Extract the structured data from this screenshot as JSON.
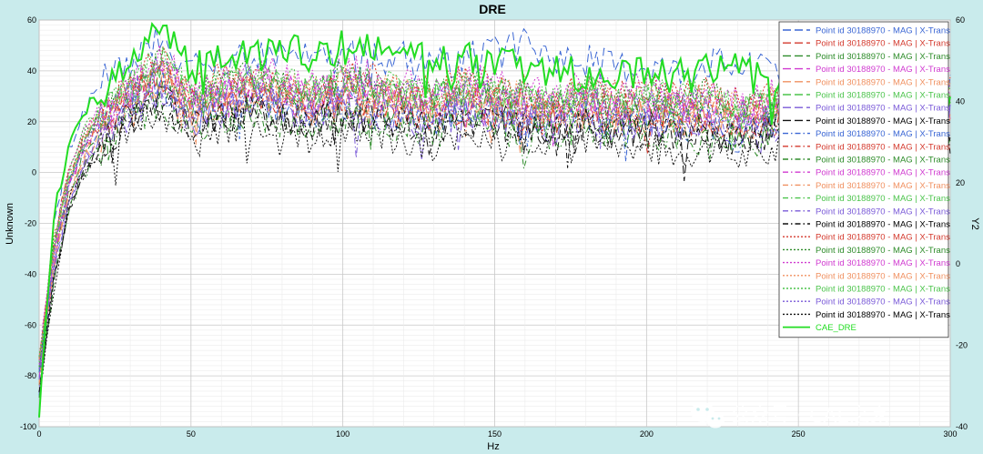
{
  "chart_data": {
    "type": "line",
    "title": "DRE",
    "xlabel": "Hz",
    "ylabel": "Unknown",
    "y2label": "Y2",
    "xlim": [
      0,
      300
    ],
    "ylim": [
      -100,
      60
    ],
    "y2lim": [
      -40,
      60
    ],
    "x_ticks": [
      0,
      50,
      100,
      150,
      200,
      250,
      300
    ],
    "y_ticks": [
      -100,
      -80,
      -60,
      -40,
      -20,
      0,
      20,
      40,
      60
    ],
    "y2_ticks": [
      -40,
      -20,
      0,
      20,
      40,
      60
    ],
    "grid": true,
    "legend_position": "top-right",
    "x": [
      0,
      5,
      10,
      15,
      20,
      25,
      30,
      35,
      40,
      45,
      50,
      60,
      70,
      80,
      90,
      100,
      110,
      120,
      130,
      140,
      150,
      160,
      170,
      180,
      190,
      200,
      210,
      220,
      230,
      240,
      250,
      260,
      270,
      280,
      290,
      300
    ],
    "series": [
      {
        "name": "Point id 30188970 - MAG | X-Trans",
        "color": "#3a66d4",
        "dash": "long",
        "values": [
          -85,
          -20,
          10,
          25,
          35,
          42,
          43,
          48,
          52,
          45,
          40,
          42,
          46,
          48,
          44,
          46,
          44,
          45,
          42,
          44,
          47,
          50,
          46,
          44,
          42,
          43,
          40,
          44,
          42,
          40,
          38,
          36,
          34,
          32,
          30,
          32
        ]
      },
      {
        "name": "Point id 30188970 - MAG | X-Trans",
        "color": "#d43a2e",
        "dash": "long",
        "values": [
          -75,
          -30,
          -5,
          10,
          18,
          25,
          30,
          35,
          38,
          32,
          26,
          30,
          34,
          30,
          28,
          34,
          30,
          28,
          26,
          30,
          28,
          26,
          25,
          28,
          24,
          26,
          25,
          24,
          22,
          24,
          26,
          22,
          20,
          22,
          24,
          26
        ]
      },
      {
        "name": "Point id 30188970 - MAG | X-Trans",
        "color": "#2e8c2a",
        "dash": "long",
        "values": [
          -80,
          -35,
          -8,
          8,
          15,
          22,
          28,
          32,
          36,
          30,
          25,
          28,
          32,
          28,
          26,
          30,
          28,
          26,
          24,
          28,
          26,
          24,
          22,
          25,
          22,
          24,
          22,
          22,
          20,
          22,
          24,
          20,
          18,
          20,
          22,
          24
        ]
      },
      {
        "name": "Point id 30188970 - MAG | X-Trans",
        "color": "#d03ad0",
        "dash": "long",
        "values": [
          -78,
          -32,
          -6,
          12,
          20,
          26,
          32,
          38,
          42,
          35,
          30,
          32,
          36,
          34,
          30,
          34,
          32,
          30,
          28,
          32,
          30,
          28,
          27,
          30,
          26,
          28,
          27,
          26,
          24,
          26,
          28,
          24,
          22,
          24,
          26,
          27
        ]
      },
      {
        "name": "Point id 30188970 - MAG | X-Trans",
        "color": "#f09060",
        "dash": "long",
        "values": [
          -82,
          -36,
          -10,
          6,
          14,
          20,
          26,
          30,
          34,
          28,
          22,
          26,
          30,
          26,
          24,
          28,
          26,
          24,
          22,
          26,
          24,
          22,
          20,
          23,
          20,
          22,
          20,
          20,
          18,
          20,
          22,
          18,
          16,
          18,
          20,
          22
        ]
      },
      {
        "name": "Point id 30188970 - MAG | X-Trans",
        "color": "#4cc44c",
        "dash": "long",
        "values": [
          -76,
          -28,
          -2,
          14,
          22,
          28,
          34,
          40,
          44,
          38,
          32,
          34,
          38,
          36,
          32,
          36,
          34,
          32,
          30,
          34,
          32,
          30,
          29,
          32,
          28,
          30,
          29,
          28,
          26,
          28,
          30,
          26,
          24,
          26,
          28,
          29
        ]
      },
      {
        "name": "Point id 30188970 - MAG | X-Trans",
        "color": "#7a5ad8",
        "dash": "long",
        "values": [
          -84,
          -38,
          -12,
          4,
          12,
          18,
          24,
          28,
          32,
          26,
          20,
          24,
          28,
          24,
          22,
          26,
          24,
          22,
          20,
          24,
          22,
          20,
          18,
          21,
          18,
          20,
          18,
          18,
          16,
          18,
          20,
          16,
          14,
          16,
          18,
          20
        ]
      },
      {
        "name": "Point id 30188970 - MAG | X-Trans",
        "color": "#111111",
        "dash": "long",
        "values": [
          -86,
          -40,
          -14,
          2,
          10,
          16,
          22,
          26,
          30,
          24,
          18,
          22,
          26,
          22,
          20,
          24,
          22,
          20,
          18,
          22,
          20,
          18,
          16,
          19,
          16,
          18,
          16,
          16,
          14,
          16,
          18,
          14,
          12,
          14,
          16,
          18
        ]
      },
      {
        "name": "Point id 30188970 - MAG | X-Trans",
        "color": "#3a66d4",
        "dash": "dashdot",
        "values": [
          -80,
          -30,
          -4,
          10,
          18,
          24,
          30,
          34,
          38,
          30,
          24,
          28,
          30,
          26,
          24,
          28,
          24,
          22,
          20,
          24,
          22,
          16,
          20,
          22,
          18,
          20,
          18,
          20,
          16,
          18,
          20,
          18,
          16,
          18,
          20,
          22
        ]
      },
      {
        "name": "Point id 30188970 - MAG | X-Trans",
        "color": "#d43a2e",
        "dash": "dashdot",
        "values": [
          -74,
          -26,
          0,
          14,
          22,
          26,
          32,
          36,
          40,
          32,
          26,
          30,
          32,
          28,
          26,
          30,
          26,
          24,
          22,
          26,
          24,
          22,
          22,
          24,
          20,
          22,
          20,
          22,
          18,
          20,
          22,
          20,
          18,
          20,
          22,
          24
        ]
      },
      {
        "name": "Point id 30188970 - MAG | X-Trans",
        "color": "#2e8c2a",
        "dash": "dashdot",
        "values": [
          -88,
          -42,
          -16,
          0,
          8,
          14,
          20,
          24,
          28,
          22,
          16,
          20,
          24,
          20,
          18,
          22,
          20,
          18,
          16,
          20,
          18,
          16,
          14,
          17,
          14,
          16,
          14,
          14,
          12,
          14,
          16,
          12,
          10,
          12,
          14,
          16
        ]
      },
      {
        "name": "Point id 30188970 - MAG | X-Trans",
        "color": "#d03ad0",
        "dash": "dashdot",
        "values": [
          -79,
          -31,
          -5,
          11,
          19,
          25,
          31,
          37,
          41,
          34,
          29,
          31,
          35,
          33,
          29,
          33,
          31,
          29,
          27,
          31,
          29,
          27,
          26,
          29,
          25,
          27,
          26,
          25,
          23,
          25,
          27,
          23,
          21,
          23,
          25,
          26
        ]
      },
      {
        "name": "Point id 30188970 - MAG | X-Trans",
        "color": "#f09060",
        "dash": "dashdot",
        "values": [
          -81,
          -33,
          -7,
          9,
          17,
          23,
          29,
          33,
          37,
          30,
          25,
          28,
          32,
          29,
          27,
          31,
          29,
          27,
          25,
          28,
          27,
          25,
          23,
          26,
          23,
          25,
          23,
          23,
          21,
          23,
          25,
          21,
          19,
          21,
          23,
          25
        ]
      },
      {
        "name": "Point id 30188970 - MAG | X-Trans",
        "color": "#4cc44c",
        "dash": "dashdot",
        "values": [
          -77,
          -29,
          -3,
          13,
          21,
          27,
          33,
          39,
          43,
          37,
          31,
          33,
          37,
          35,
          31,
          35,
          33,
          31,
          29,
          33,
          31,
          29,
          28,
          31,
          27,
          29,
          28,
          27,
          25,
          27,
          29,
          25,
          23,
          25,
          27,
          28
        ]
      },
      {
        "name": "Point id 30188970 - MAG | X-Trans",
        "color": "#7a5ad8",
        "dash": "dashdot",
        "values": [
          -83,
          -37,
          -11,
          5,
          13,
          19,
          25,
          29,
          33,
          27,
          21,
          25,
          29,
          25,
          23,
          27,
          25,
          23,
          21,
          25,
          23,
          21,
          19,
          22,
          19,
          21,
          19,
          19,
          17,
          19,
          21,
          17,
          15,
          17,
          19,
          21
        ]
      },
      {
        "name": "Point id 30188970 - MAG | X-Trans",
        "color": "#111111",
        "dash": "dashdot",
        "values": [
          -87,
          -41,
          -15,
          1,
          9,
          15,
          21,
          25,
          29,
          23,
          17,
          21,
          25,
          21,
          19,
          23,
          21,
          19,
          17,
          21,
          19,
          17,
          15,
          18,
          15,
          17,
          15,
          15,
          13,
          15,
          17,
          13,
          11,
          13,
          15,
          17
        ]
      },
      {
        "name": "Point id 30188970 - MAG | X-Trans",
        "color": "#d43a2e",
        "dash": "dot",
        "values": [
          -72,
          -24,
          2,
          16,
          24,
          28,
          34,
          40,
          46,
          38,
          32,
          36,
          40,
          36,
          34,
          40,
          36,
          34,
          32,
          36,
          34,
          32,
          30,
          34,
          30,
          32,
          30,
          32,
          28,
          30,
          32,
          30,
          28,
          30,
          32,
          34
        ]
      },
      {
        "name": "Point id 30188970 - MAG | X-Trans",
        "color": "#2e8c2a",
        "dash": "dot",
        "values": [
          -75,
          -27,
          -1,
          15,
          23,
          27,
          33,
          38,
          44,
          36,
          30,
          34,
          38,
          34,
          32,
          38,
          34,
          32,
          30,
          34,
          32,
          30,
          28,
          32,
          28,
          30,
          28,
          30,
          26,
          28,
          30,
          28,
          26,
          28,
          30,
          32
        ]
      },
      {
        "name": "Point id 30188970 - MAG | X-Trans",
        "color": "#d03ad0",
        "dash": "dot",
        "values": [
          -73,
          -25,
          1,
          17,
          25,
          29,
          35,
          41,
          47,
          39,
          33,
          37,
          41,
          37,
          35,
          41,
          37,
          35,
          33,
          37,
          35,
          33,
          31,
          35,
          31,
          33,
          31,
          33,
          29,
          31,
          33,
          31,
          29,
          31,
          33,
          35
        ]
      },
      {
        "name": "Point id 30188970 - MAG | X-Trans",
        "color": "#f09060",
        "dash": "dot",
        "values": [
          -76,
          -28,
          -2,
          14,
          22,
          26,
          32,
          37,
          43,
          35,
          29,
          33,
          37,
          33,
          31,
          37,
          33,
          31,
          29,
          33,
          31,
          29,
          27,
          31,
          27,
          29,
          27,
          29,
          25,
          27,
          29,
          27,
          25,
          27,
          29,
          31
        ]
      },
      {
        "name": "Point id 30188970 - MAG | X-Trans",
        "color": "#4cc44c",
        "dash": "dot",
        "values": [
          -74,
          -26,
          0,
          16,
          24,
          28,
          34,
          39,
          45,
          37,
          31,
          35,
          39,
          35,
          33,
          39,
          35,
          33,
          31,
          35,
          33,
          31,
          29,
          33,
          29,
          31,
          29,
          31,
          27,
          29,
          31,
          29,
          27,
          29,
          31,
          33
        ]
      },
      {
        "name": "Point id 30188970 - MAG | X-Trans",
        "color": "#7a5ad8",
        "dash": "dot",
        "values": [
          -78,
          -30,
          -4,
          12,
          20,
          24,
          30,
          35,
          41,
          33,
          27,
          31,
          35,
          31,
          29,
          35,
          31,
          29,
          27,
          31,
          29,
          27,
          25,
          29,
          25,
          27,
          25,
          27,
          23,
          25,
          27,
          25,
          23,
          25,
          27,
          29
        ]
      },
      {
        "name": "Point id 30188970 - MAG | X-Trans",
        "color": "#111111",
        "dash": "dot",
        "values": [
          -86,
          -45,
          -10,
          0,
          8,
          12,
          20,
          22,
          26,
          18,
          12,
          16,
          20,
          16,
          14,
          18,
          16,
          14,
          10,
          14,
          12,
          10,
          8,
          12,
          8,
          10,
          8,
          10,
          6,
          8,
          10,
          8,
          6,
          8,
          10,
          12
        ]
      },
      {
        "name": "CAE_DRE",
        "color": "#22dd22",
        "dash": "solid",
        "width": 2,
        "values": [
          -95,
          -15,
          12,
          25,
          30,
          38,
          45,
          50,
          56,
          48,
          40,
          44,
          48,
          50,
          46,
          50,
          47,
          46,
          45,
          46,
          42,
          42,
          40,
          38,
          40,
          40,
          38,
          40,
          42,
          38,
          36,
          34,
          32,
          30,
          28,
          30
        ]
      }
    ]
  },
  "watermark": {
    "text": "公众号 · CAE之家",
    "icon": "wechat-icon"
  }
}
